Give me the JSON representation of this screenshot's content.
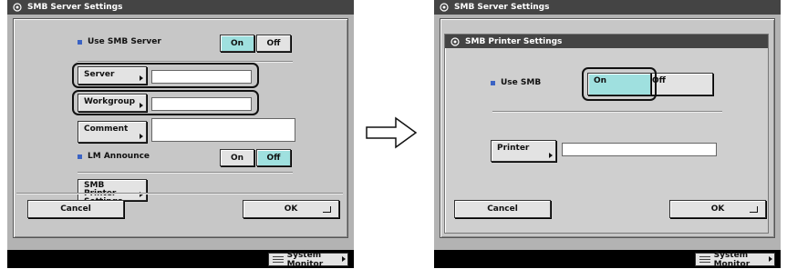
{
  "left_screen": {
    "title": "SMB Server Settings",
    "use_smb_server_label": "Use SMB Server",
    "on_label": "On",
    "off_label": "Off",
    "server_label": "Server",
    "workgroup_label": "Workgroup",
    "comment_label": "Comment",
    "lm_announce_label": "LM Announce",
    "lm_on_label": "On",
    "lm_off_label": "Off",
    "smb_printer_settings_label": "SMB Printer Settings",
    "cancel_label": "Cancel",
    "ok_label": "OK",
    "system_monitor_label": "System Monitor"
  },
  "right_screen": {
    "title": "SMB Server Settings",
    "subtitle": "SMB Printer Settings",
    "use_smb_label": "Use SMB",
    "on_label": "On",
    "off_label": "Off",
    "printer_label": "Printer",
    "cancel_label": "Cancel",
    "ok_label": "OK",
    "system_monitor_label": "System Monitor"
  },
  "colors": {
    "selected_button": "#9fe0df",
    "bullet": "#3b63c4",
    "titlebar": "#444444"
  }
}
